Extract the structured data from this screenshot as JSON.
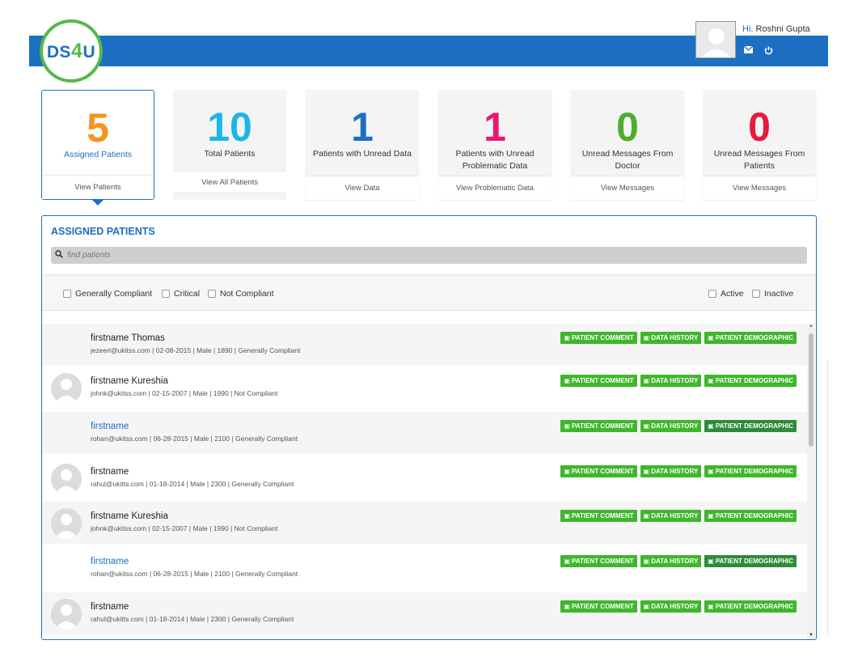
{
  "header": {
    "logo_prefix": "DS",
    "logo_four": "4",
    "logo_suffix": "U",
    "greeting_hi": "Hi,",
    "user_name": "Roshni Gupta",
    "mail_icon": "envelope-icon",
    "power_icon": "power-icon"
  },
  "colors": {
    "brand_blue": "#1c6fc2",
    "brand_green": "#55b948",
    "button_green": "#3fb62c"
  },
  "cards": [
    {
      "value": "5",
      "label": "Assigned Patients",
      "link": "View Patients",
      "color": "#f7931e"
    },
    {
      "value": "10",
      "label": "Total Patients",
      "link": "View All Patients",
      "color": "#1ab6e8"
    },
    {
      "value": "1",
      "label": "Patients with Unread Data",
      "link": "View Data",
      "color": "#1c6fc2"
    },
    {
      "value": "1",
      "label": "Patients with Unread Problematic Data",
      "link": "View Problematic Data",
      "color": "#e8196e"
    },
    {
      "value": "0",
      "label": "Unread Messages From Doctor",
      "link": "View Messages",
      "color": "#4fae2e"
    },
    {
      "value": "0",
      "label": "Unread Messages From Patients",
      "link": "View Messages",
      "color": "#e81a3c"
    }
  ],
  "panel": {
    "title": "ASSIGNED PATIENTS",
    "search_placeholder": "find patients",
    "filters_left": [
      "Generally Compliant",
      "Critical",
      "Not Compliant"
    ],
    "filters_right": [
      "Active",
      "Inactive"
    ]
  },
  "buttons": {
    "comment": "PATIENT COMMENT",
    "history": "DATA HISTORY",
    "demographic": "PATIENT DEMOGRAPHIC"
  },
  "patients": [
    {
      "name": "firstname Thomas",
      "meta": "jezeerl@ukitss.com | 02-08-2015 | Male | 1890 | Generally Compliant"
    },
    {
      "name": "firstname Kureshia",
      "meta": "johnk@ukitss.com | 02-15-2007 | Male | 1990 | Not Compliant"
    },
    {
      "name": "firstname",
      "meta": "rohan@ukitss.com | 06-28-2015 | Male | 2100 | Generally Compliant"
    },
    {
      "name": "firstname",
      "meta": "rahul@ukitts.com | 01-18-2014 | Male | 2300 | Generally Compliant"
    },
    {
      "name": "firstname Kureshia",
      "meta": "johnk@ukitss.com | 02-15-2007 | Male | 1990 | Not Compliant"
    },
    {
      "name": "firstname",
      "meta": "rohan@ukitss.com | 06-28-2015 | Male | 2100 | Generally Compliant"
    },
    {
      "name": "firstname",
      "meta": "rahul@ukitts.com | 01-18-2014 | Male | 2300 | Generally Compliant"
    }
  ]
}
